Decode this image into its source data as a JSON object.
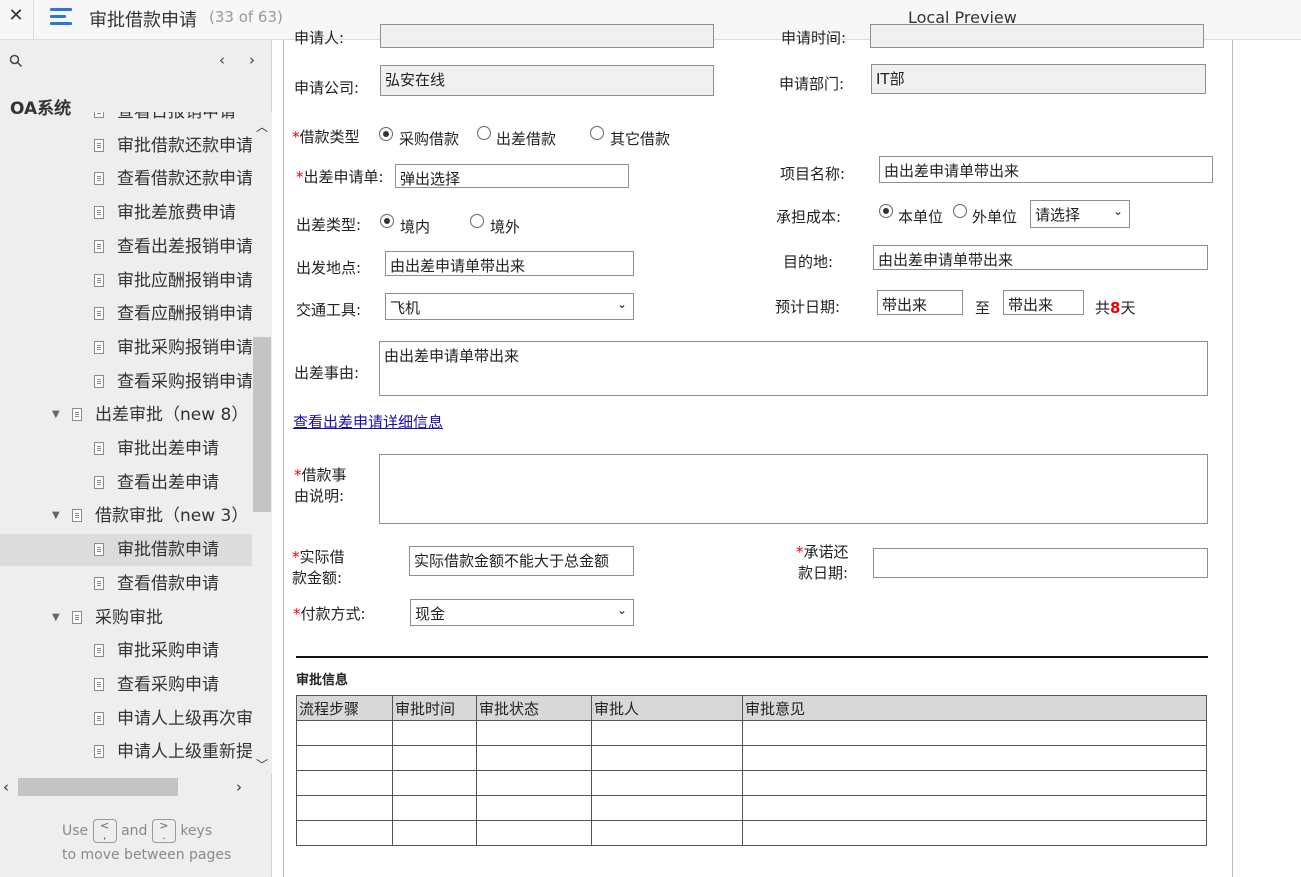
{
  "topbar": {
    "close_label": "✕",
    "title": "审批借款申请",
    "page_counter": "(33 of 63)",
    "preview_title": "Local Preview"
  },
  "sidebar": {
    "project_title": "OA系统",
    "prev_arrow": "‹",
    "next_arrow": "›",
    "items": [
      {
        "label": "查看日报销申请",
        "level": 2,
        "type": "page"
      },
      {
        "label": "审批借款还款申请",
        "level": 2,
        "type": "page"
      },
      {
        "label": "查看借款还款申请",
        "level": 2,
        "type": "page"
      },
      {
        "label": "审批差旅费申请",
        "level": 2,
        "type": "page"
      },
      {
        "label": "查看出差报销申请",
        "level": 2,
        "type": "page"
      },
      {
        "label": "审批应酬报销申请",
        "level": 2,
        "type": "page"
      },
      {
        "label": "查看应酬报销申请",
        "level": 2,
        "type": "page"
      },
      {
        "label": "审批采购报销申请",
        "level": 2,
        "type": "page"
      },
      {
        "label": "查看采购报销申请",
        "level": 2,
        "type": "page"
      },
      {
        "label": "出差审批（new 8）",
        "level": 1,
        "type": "folder"
      },
      {
        "label": "审批出差申请",
        "level": 2,
        "type": "page"
      },
      {
        "label": "查看出差申请",
        "level": 2,
        "type": "page"
      },
      {
        "label": "借款审批（new 3）",
        "level": 1,
        "type": "folder"
      },
      {
        "label": "审批借款申请",
        "level": 2,
        "type": "page",
        "selected": true
      },
      {
        "label": "查看借款申请",
        "level": 2,
        "type": "page"
      },
      {
        "label": "采购审批",
        "level": 1,
        "type": "folder"
      },
      {
        "label": "审批采购申请",
        "level": 2,
        "type": "page"
      },
      {
        "label": "查看采购申请",
        "level": 2,
        "type": "page"
      },
      {
        "label": "申请人上级再次审",
        "level": 2,
        "type": "page"
      },
      {
        "label": "申请人上级重新提",
        "level": 2,
        "type": "page"
      }
    ],
    "hint_use": "Use",
    "hint_and": "and",
    "hint_keys": "keys",
    "hint_line2": "to move between pages",
    "key_prev": "<\n,",
    "key_next": ">\n."
  },
  "form": {
    "row0_left_label": "申请人:",
    "row0_right_label": "申请时间:",
    "company_label": "申请公司:",
    "company_value": "弘安在线",
    "dept_label": "申请部门:",
    "dept_value": "IT部",
    "loan_type_label": "借款类型",
    "loan_type_options": [
      "采购借款",
      "出差借款",
      "其它借款"
    ],
    "trip_form_label": "出差申请单:",
    "trip_form_value": "弹出选择",
    "project_label": "项目名称:",
    "project_value": "由出差申请单带出来",
    "trip_type_label": "出差类型:",
    "trip_type_options": [
      "境内",
      "境外"
    ],
    "cost_label": "承担成本:",
    "cost_options": [
      "本单位",
      "外单位"
    ],
    "cost_select": "请选择",
    "depart_label": "出发地点:",
    "depart_value": "由出差申请单带出来",
    "dest_label": "目的地:",
    "dest_value": "由出差申请单带出来",
    "transport_label": "交通工具:",
    "transport_value": "飞机",
    "date_label": "预计日期:",
    "date_from": "带出来",
    "date_to_label": "至",
    "date_to": "带出来",
    "days_prefix": "共",
    "days_value": "8",
    "days_suffix": "天",
    "reason_label": "出差事由:",
    "reason_value": "由出差申请单带出来",
    "detail_link": "查看出差申请详细信息",
    "loan_reason_label_1": "借款事",
    "loan_reason_label_2": "由说明:",
    "amount_label_1": "实际借",
    "amount_label_2": "款金额:",
    "amount_value": "实际借款金额不能大于总金额",
    "repay_label_1": "承诺还",
    "repay_label_2": "款日期:",
    "pay_label": "付款方式:",
    "pay_value": "现金",
    "required_mark": "*"
  },
  "approval": {
    "title": "审批信息",
    "columns": [
      "流程步骤",
      "审批时间",
      "审批状态",
      "审批人",
      "审批意见"
    ],
    "empty_rows": 5
  },
  "colors": {
    "accent": "#2a7ad5",
    "required": "#ee0000",
    "days_highlight": "#ee0000",
    "link": "#1a0dab"
  }
}
